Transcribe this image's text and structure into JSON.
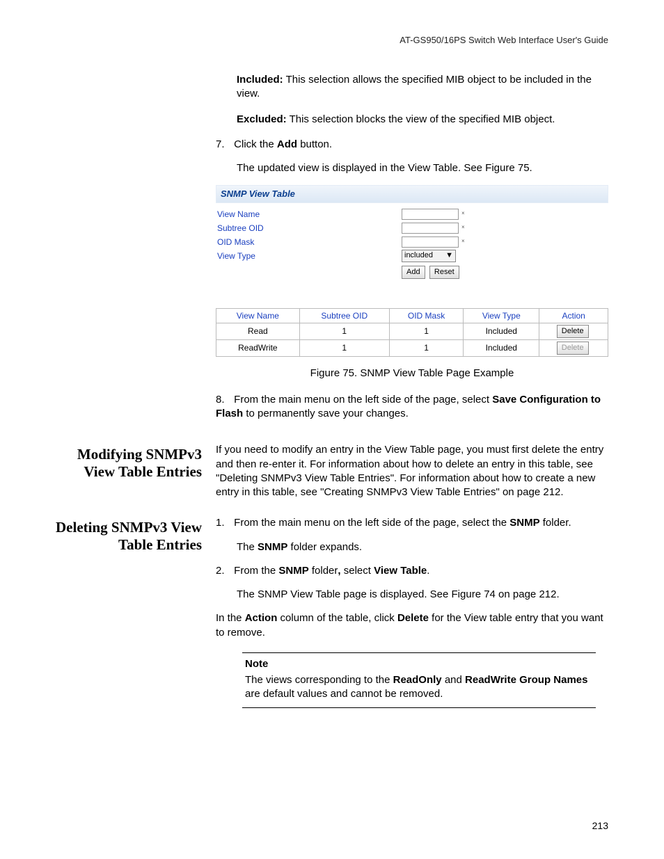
{
  "header": {
    "guide_title": "AT-GS950/16PS Switch Web Interface User's Guide"
  },
  "section_top": {
    "included_label": "Included:",
    "included_text": " This selection allows the specified MIB object to be included in the view.",
    "excluded_label": "Excluded:",
    "excluded_text": " This selection blocks the view of the specified MIB object.",
    "step7_num": "7.",
    "step7_text_a": "Click the ",
    "step7_bold": "Add",
    "step7_text_b": " button.",
    "step7_follow": "The updated view is displayed in the View Table. See Figure 75."
  },
  "figure": {
    "panel_title": "SNMP View Table",
    "labels": {
      "view_name": "View Name",
      "subtree_oid": "Subtree OID",
      "oid_mask": "OID Mask",
      "view_type": "View Type"
    },
    "dropdown_value": "included",
    "buttons": {
      "add": "Add",
      "reset": "Reset"
    },
    "table": {
      "headers": [
        "View Name",
        "Subtree OID",
        "OID Mask",
        "View Type",
        "Action"
      ],
      "rows": [
        {
          "cells": [
            "Read",
            "1",
            "1",
            "Included"
          ],
          "action": "Delete",
          "action_enabled": true
        },
        {
          "cells": [
            "ReadWrite",
            "1",
            "1",
            "Included"
          ],
          "action": "Delete",
          "action_enabled": false
        }
      ]
    },
    "caption": "Figure 75. SNMP View Table Page Example"
  },
  "step8": {
    "num": "8.",
    "text_a": "From the main menu on the left side of the page, select ",
    "bold_a": "Save Configuration to Flash",
    "text_b": " to permanently save your changes."
  },
  "modifying": {
    "heading": "Modifying SNMPv3 View Table Entries",
    "body": "If you need to modify an entry in the View Table page, you must first delete the entry and then re-enter it. For information about how to delete an entry in this table, see \"Deleting SNMPv3 View Table Entries\". For information about how to create a new entry in this table, see \"Creating SNMPv3 View Table Entries\" on page 212."
  },
  "deleting": {
    "heading": "Deleting SNMPv3 View Table Entries",
    "step1_num": "1.",
    "step1_a": "From the main menu on the left side of the page, select the ",
    "step1_bold": "SNMP",
    "step1_b": " folder.",
    "step1_follow_a": "The ",
    "step1_follow_bold": "SNMP",
    "step1_follow_b": " folder expands.",
    "step2_num": "2.",
    "step2_a": "From the ",
    "step2_bold_a": "SNMP",
    "step2_b": " folder",
    "step2_bold_comma": ",",
    "step2_c": " select ",
    "step2_bold_b": "View Table",
    "step2_d": ".",
    "step2_follow": "The SNMP View Table page is displayed. See Figure 74 on page 212.",
    "action_a": "In the ",
    "action_bold_a": "Action",
    "action_b": " column of the table, click ",
    "action_bold_b": "Delete",
    "action_c": " for the View table entry that you want to remove."
  },
  "note": {
    "label": "Note",
    "line_a": "The views corresponding to the ",
    "bold_a": "ReadOnly",
    "line_b": " and ",
    "bold_b": "ReadWrite Group Names",
    "line_c": " are default values and cannot be removed."
  },
  "footer": {
    "page_number": "213"
  }
}
